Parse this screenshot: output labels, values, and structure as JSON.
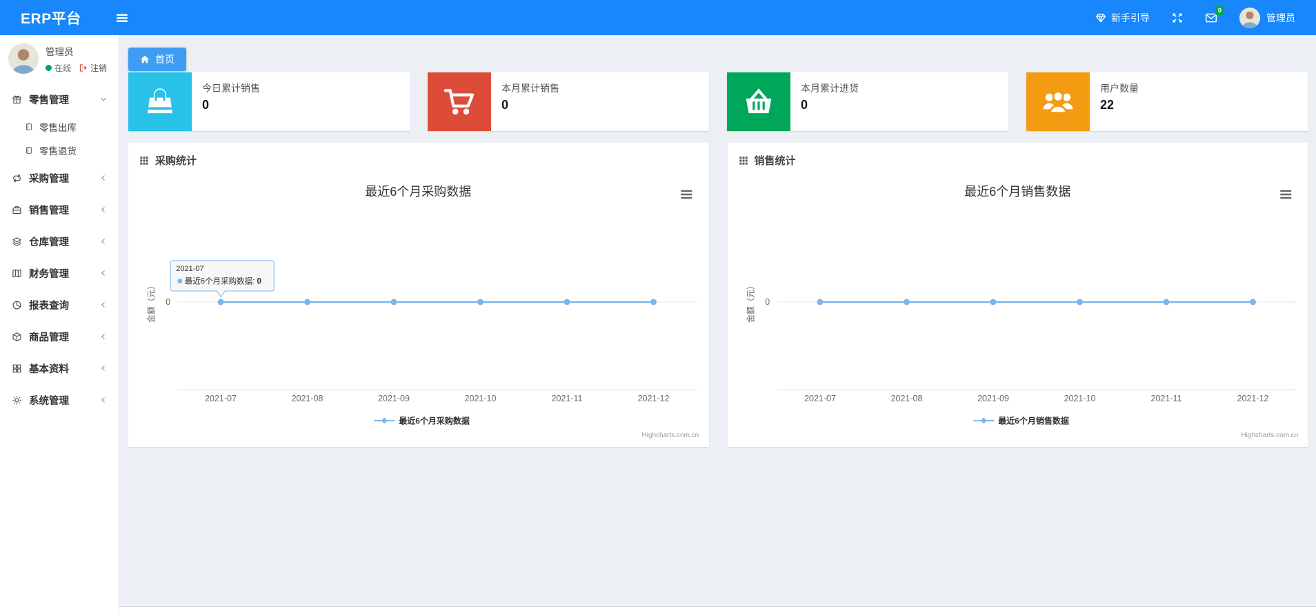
{
  "colors": {
    "navbar": "#1787fb",
    "tab": "#3d9df3",
    "content_bg": "#ecf0f5",
    "chart_line": "#7cb5ec",
    "online": "#00a65a",
    "logout": "#dd4b39",
    "mail_badge_bg": "#00a65a"
  },
  "navbar": {
    "brand": "ERP平台",
    "menu_icon": "bars-icon",
    "guide": {
      "icon": "gem-icon",
      "label": "新手引导"
    },
    "fullscreen_icon": "expand-icon",
    "mail": {
      "icon": "envelope-icon",
      "badge": "0"
    },
    "user": {
      "avatar_icon": "avatar-icon",
      "name": "管理员"
    }
  },
  "sidebar": {
    "user": {
      "avatar_icon": "avatar-icon",
      "name": "管理员",
      "online_label": "在线",
      "logout_icon": "signout-icon",
      "logout_label": "注销"
    },
    "menu": [
      {
        "label": "零售管理",
        "icon": "gift-icon",
        "state": "expanded",
        "children": [
          {
            "label": "零售出库",
            "icon": "file-icon"
          },
          {
            "label": "零售退货",
            "icon": "file-icon"
          }
        ]
      },
      {
        "label": "采购管理",
        "icon": "repeat-icon",
        "state": "collapsed"
      },
      {
        "label": "销售管理",
        "icon": "briefcase-icon",
        "state": "collapsed"
      },
      {
        "label": "仓库管理",
        "icon": "layers-icon",
        "state": "collapsed"
      },
      {
        "label": "财务管理",
        "icon": "map-icon",
        "state": "collapsed"
      },
      {
        "label": "报表查询",
        "icon": "pie-chart-icon",
        "state": "collapsed"
      },
      {
        "label": "商品管理",
        "icon": "box-icon",
        "state": "collapsed"
      },
      {
        "label": "基本资料",
        "icon": "grid-icon",
        "state": "collapsed"
      },
      {
        "label": "系统管理",
        "icon": "gear-icon",
        "state": "collapsed"
      }
    ]
  },
  "tabs": [
    {
      "label": "首页",
      "icon": "home-icon",
      "active": true
    }
  ],
  "stat_cards": [
    {
      "label": "今日累计销售",
      "value": "0",
      "icon": "shopping-bag-icon",
      "color": "#29c1e8"
    },
    {
      "label": "本月累计销售",
      "value": "0",
      "icon": "cart-icon",
      "color": "#dd4b39"
    },
    {
      "label": "本月累计进货",
      "value": "0",
      "icon": "basket-icon",
      "color": "#00a65a"
    },
    {
      "label": "用户数量",
      "value": "22",
      "icon": "users-icon",
      "color": "#f39c12"
    }
  ],
  "chart_data": [
    {
      "type": "line",
      "panel_title": "采购统计",
      "panel_icon": "th-icon",
      "title": "最近6个月采购数据",
      "categories": [
        "2021-07",
        "2021-08",
        "2021-09",
        "2021-10",
        "2021-11",
        "2021-12"
      ],
      "series": [
        {
          "name": "最近6个月采购数据",
          "values": [
            0,
            0,
            0,
            0,
            0,
            0
          ]
        }
      ],
      "ylabel": "金额（元）",
      "yticks": [
        "0"
      ],
      "ylim": [
        -1,
        1
      ],
      "grid": true,
      "legend_position": "bottom",
      "line_color": "#7cb5ec",
      "credits": "Highcharts.com.cn",
      "tooltip": {
        "header": "2021-07",
        "series": "最近6个月采购数据",
        "value": "0"
      }
    },
    {
      "type": "line",
      "panel_title": "销售统计",
      "panel_icon": "th-icon",
      "title": "最近6个月销售数据",
      "categories": [
        "2021-07",
        "2021-08",
        "2021-09",
        "2021-10",
        "2021-11",
        "2021-12"
      ],
      "series": [
        {
          "name": "最近6个月销售数据",
          "values": [
            0,
            0,
            0,
            0,
            0,
            0
          ]
        }
      ],
      "ylabel": "金额（元）",
      "yticks": [
        "0"
      ],
      "ylim": [
        -1,
        1
      ],
      "grid": true,
      "legend_position": "bottom",
      "line_color": "#7cb5ec",
      "credits": "Highcharts.com.cn"
    }
  ]
}
